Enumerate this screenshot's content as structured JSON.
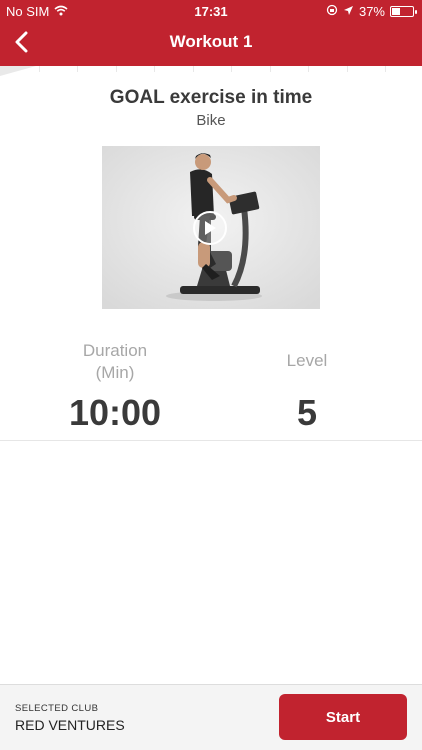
{
  "status_bar": {
    "carrier": "No SIM",
    "time": "17:31",
    "battery": "37%"
  },
  "nav": {
    "title": "Workout 1",
    "back_icon": "chevron-left-icon"
  },
  "exercise": {
    "title": "GOAL exercise in time",
    "subtitle": "Bike"
  },
  "stats": {
    "duration_label_line1": "Duration",
    "duration_label_line2": "(Min)",
    "duration_value": "10:00",
    "level_label": "Level",
    "level_value": "5"
  },
  "footer": {
    "club_caption": "SELECTED CLUB",
    "club_name": "RED VENTURES",
    "start_label": "Start"
  },
  "colors": {
    "brand": "#c1232f",
    "text": "#3a3a3a",
    "muted": "#a7a7a7"
  }
}
